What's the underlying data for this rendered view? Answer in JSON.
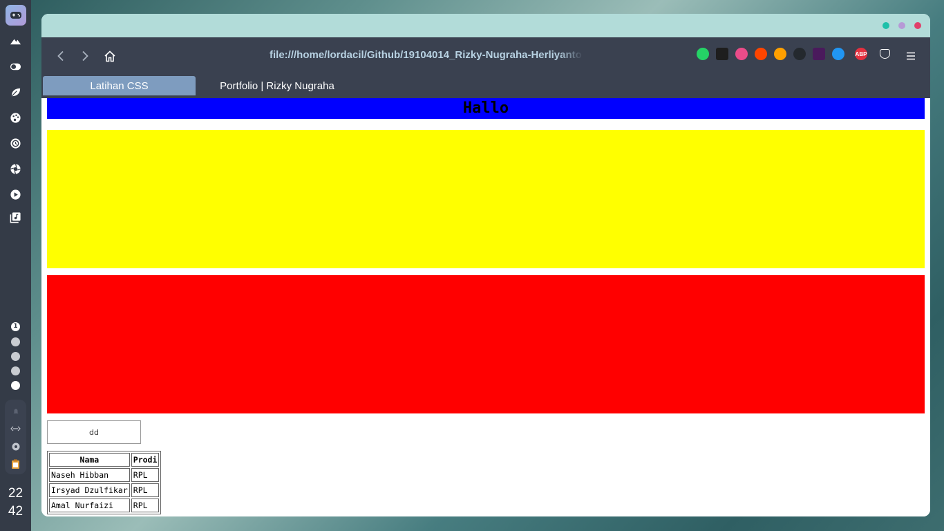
{
  "dock": {
    "apps": [
      "gamepad-icon",
      "mountain-icon",
      "toggle-icon",
      "leaf-icon",
      "palette-icon",
      "history-icon",
      "aperture-icon",
      "play-icon",
      "music-library-icon"
    ],
    "workspaces": [
      "1",
      "",
      "",
      "",
      ""
    ],
    "tray": [
      "bell-icon",
      "code-arrows-icon",
      "settings-icon",
      "clipboard-icon"
    ],
    "clock": {
      "hour": "22",
      "minute": "42"
    }
  },
  "browser": {
    "url": "file:///home/lordacil/Github/19104014_Rizky-Nugraha-Herliyanto",
    "extensions": [
      {
        "name": "whatsapp-icon",
        "color": "#25d366",
        "label": ""
      },
      {
        "name": "figma-icon",
        "color": "#1e1e1e",
        "label": ""
      },
      {
        "name": "dribbble-icon",
        "color": "#ea4c89",
        "label": ""
      },
      {
        "name": "reddit-icon",
        "color": "#ff4500",
        "label": ""
      },
      {
        "name": "firebase-icon",
        "color": "#ffa000",
        "label": ""
      },
      {
        "name": "github-icon",
        "color": "#24292e",
        "label": ""
      },
      {
        "name": "podcast-icon",
        "color": "#4a1a5c",
        "label": ""
      },
      {
        "name": "dart-icon",
        "color": "#2196f3",
        "label": ""
      },
      {
        "name": "adblock-icon",
        "color": "#e5303f",
        "label": "ABP"
      },
      {
        "name": "pocket-icon",
        "color": "#3a4150",
        "label": ""
      }
    ],
    "tabs": [
      {
        "label": "Latihan CSS",
        "active": true
      },
      {
        "label": "Portfolio | Rizky Nugraha",
        "active": false
      }
    ],
    "window_buttons": [
      "#1fc0a9",
      "#b69ad6",
      "#e0406a"
    ]
  },
  "page": {
    "heading": "Hallo",
    "button_label": "dd",
    "table": {
      "headers": [
        "Nama",
        "Prodi"
      ],
      "rows": [
        [
          "Naseh Hibban",
          "RPL"
        ],
        [
          "Irsyad Dzulfikar",
          "RPL"
        ],
        [
          "Amal Nurfaizi",
          "RPL"
        ]
      ]
    }
  }
}
